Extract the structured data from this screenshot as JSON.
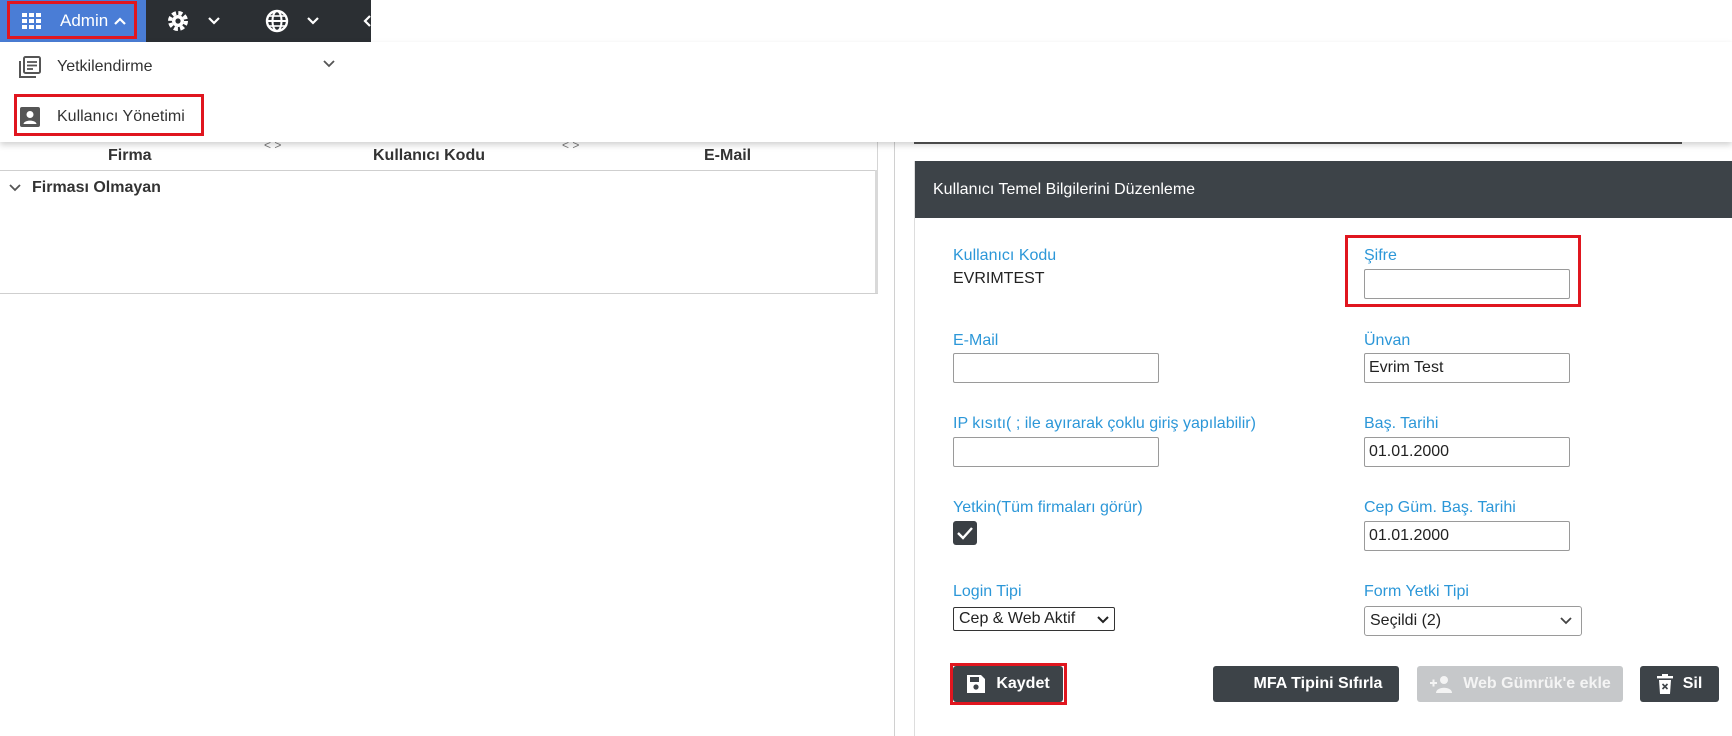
{
  "topbar": {
    "admin_label": "Admin",
    "icons": [
      "grid-icon",
      "gear-icon",
      "globe-icon",
      "chevron-down-icon"
    ]
  },
  "dropdown": {
    "items": [
      {
        "label": "Yetkilendirme",
        "icon": "list-icon"
      },
      {
        "label": "Kullanıcı Yönetimi",
        "icon": "user-icon"
      }
    ]
  },
  "table": {
    "columns": [
      "Firma",
      "Kullanıcı Kodu",
      "E-Mail"
    ],
    "group_label": "Firması Olmayan"
  },
  "panel": {
    "title": "Kullanıcı Temel Bilgilerini Düzenleme",
    "kullanici_kodu_label": "Kullanıcı Kodu",
    "kullanici_kodu_value": "EVRIMTEST",
    "sifre_label": "Şifre",
    "sifre_value": "",
    "email_label": "E-Mail",
    "email_value": "",
    "unvan_label": "Ünvan",
    "unvan_value": "Evrim Test",
    "ip_label": "IP kısıtı( ; ile ayırarak çoklu giriş yapılabilir)",
    "ip_value": "",
    "bas_tarihi_label": "Baş. Tarihi",
    "bas_tarihi_value": "01.01.2000",
    "yetkin_label": "Yetkin(Tüm firmaları görür)",
    "yetkin_checked": true,
    "cep_label": "Cep Güm. Baş. Tarihi",
    "cep_value": "01.01.2000",
    "login_label": "Login Tipi",
    "login_value": "Cep & Web Aktif",
    "form_yetki_label": "Form Yetki Tipi",
    "form_yetki_value": "Seçildi (2)"
  },
  "buttons": {
    "kaydet": "Kaydet",
    "mfa": "MFA Tipini Sıfırla",
    "web_gumruk": "Web Gümrük'e ekle",
    "sil": "Sil"
  },
  "colors": {
    "accent": "#4a7dd6",
    "dark": "#3d4348",
    "label_blue": "#2c97d8",
    "highlight_red": "#e0161f",
    "disabled": "#c6c8ca"
  }
}
